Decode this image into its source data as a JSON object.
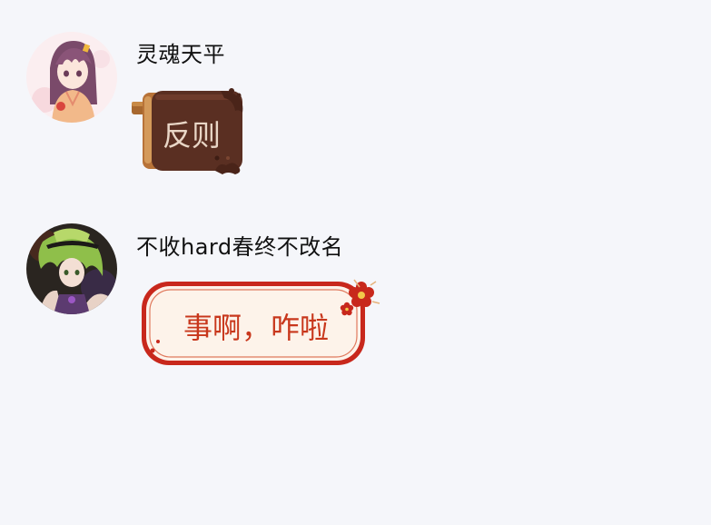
{
  "messages": [
    {
      "sender": "灵魂天平",
      "text": "反则",
      "avatar_icon": "anime-girl-avatar",
      "bubble_style": "chocolate-toaster"
    },
    {
      "sender": "不收hard春终不改名",
      "text": "事啊，咋啦",
      "avatar_icon": "anime-green-hair-avatar",
      "bubble_style": "red-festive-plum-blossom"
    }
  ],
  "colors": {
    "background": "#f5f6fa",
    "choco_bubble": "#5a2f22",
    "choco_text": "#e9d6c6",
    "festive_border": "#c8281c",
    "festive_fill": "#fdf3ea",
    "festive_text": "#c8371c"
  }
}
